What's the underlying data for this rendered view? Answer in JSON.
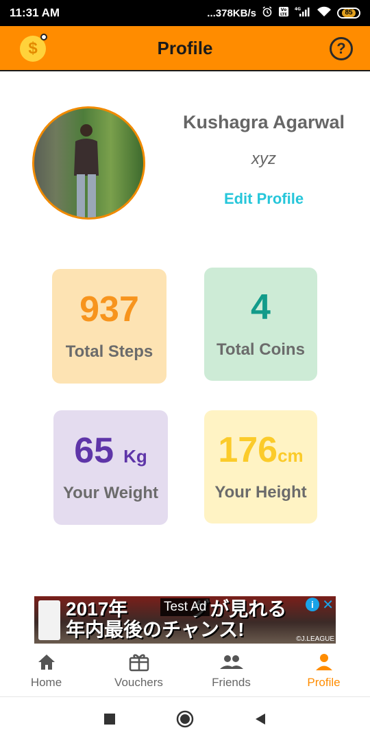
{
  "status_bar": {
    "time": "11:31 AM",
    "network_speed": "...378KB/s",
    "network_type": "4G",
    "battery": "85"
  },
  "app_bar": {
    "title": "Profile",
    "coin_icon": "dollar-coin-icon",
    "help_icon": "help-circle-icon",
    "help_glyph": "?",
    "coin_glyph": "$"
  },
  "profile": {
    "name": "Kushagra Agarwal",
    "username": "xyz",
    "edit_label": "Edit Profile"
  },
  "stats": {
    "steps": {
      "value": "937",
      "label": "Total Steps",
      "color": "#f7941d"
    },
    "coins": {
      "value": "4",
      "label": "Total Coins",
      "color": "#129b8a"
    },
    "weight": {
      "value": "65",
      "unit": "Kg",
      "label": "Your Weight",
      "color": "#5e35a8"
    },
    "height": {
      "value": "176",
      "unit": "cm",
      "label": "Your Height",
      "color": "#fbcb2a"
    }
  },
  "ad": {
    "label": "Test Ad",
    "text_line1": "2017年",
    "text_line1b": "グが見れる",
    "text_line2": "年内最後のチャンス!",
    "footer": "©J.LEAGUE",
    "info_glyph": "i",
    "close_glyph": "✕"
  },
  "bottom_nav": {
    "items": [
      {
        "label": "Home",
        "icon": "home-icon"
      },
      {
        "label": "Vouchers",
        "icon": "gift-icon"
      },
      {
        "label": "Friends",
        "icon": "friends-icon"
      },
      {
        "label": "Profile",
        "icon": "person-icon",
        "active": true
      }
    ],
    "active_color": "#ff8c00"
  },
  "system_nav": {
    "recents_icon": "square-icon",
    "home_icon": "circle-icon",
    "back_icon": "back-triangle-icon"
  }
}
